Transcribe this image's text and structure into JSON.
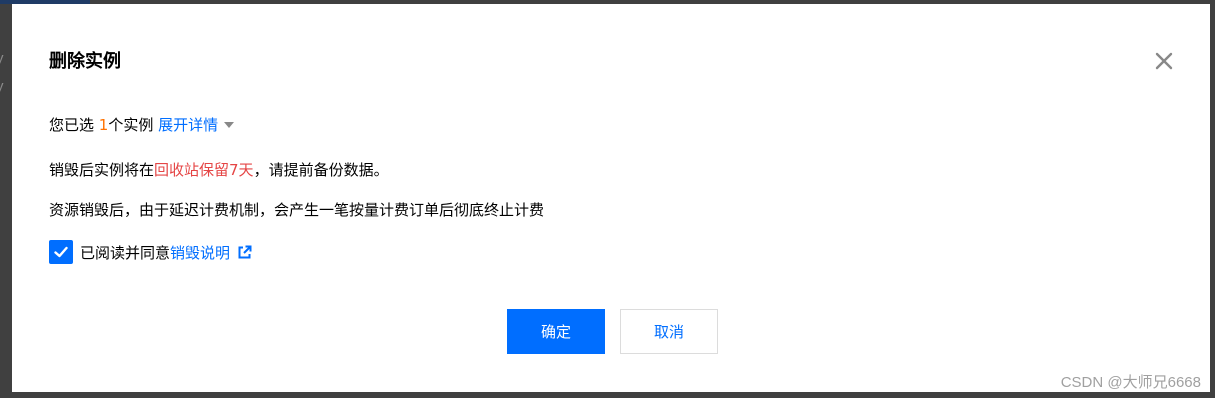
{
  "background": {
    "fragment_1": "y",
    "fragment_2": "y"
  },
  "dialog": {
    "title": "删除实例",
    "close_icon": "close-icon",
    "selected": {
      "prefix": "您已选 ",
      "count": "1",
      "suffix": "个实例 ",
      "expand_link": "展开详情"
    },
    "warning": {
      "prefix": "销毁后实例将在",
      "highlight": "回收站保留7天",
      "suffix": "，请提前备份数据。"
    },
    "billing_note": "资源销毁后，由于延迟计费机制，会产生一笔按量计费订单后彻底终止计费",
    "agreement": {
      "checked": true,
      "label": "已阅读并同意",
      "link": "销毁说明",
      "link_icon": "external-link-icon"
    },
    "confirm_button": "确定",
    "cancel_button": "取消"
  },
  "watermark": "CSDN @大师兄6668",
  "colors": {
    "primary": "#006eff",
    "count": "#ff7200",
    "highlight": "#e54545",
    "overlay": "#404040"
  }
}
